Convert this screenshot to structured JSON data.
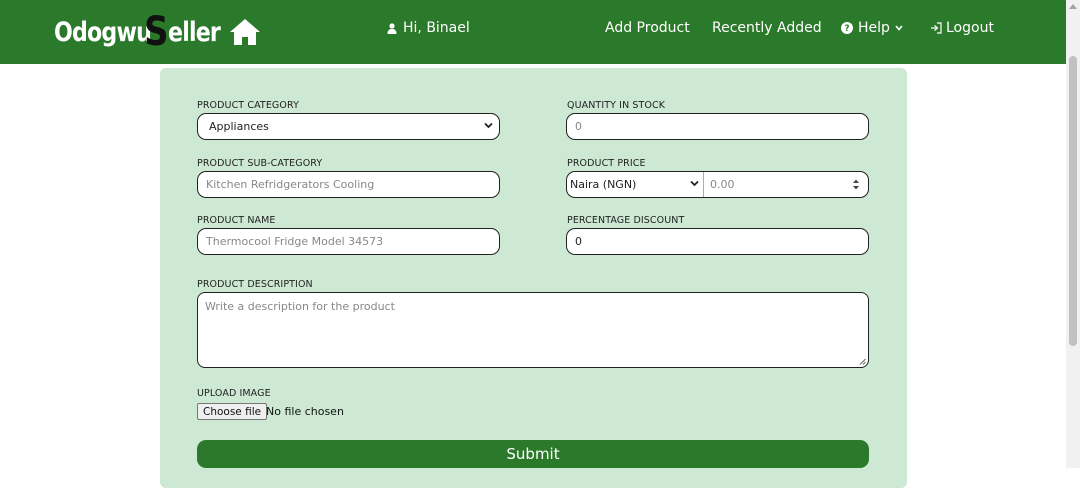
{
  "brand": {
    "part1": "Odogwu",
    "letter": "S",
    "part2": "eller",
    "icon": "home-icon"
  },
  "nav": {
    "greeting": "Hi, Binael",
    "greeting_icon": "user-icon",
    "add_product": "Add Product",
    "recently_added": "Recently Added",
    "help": "Help",
    "help_icon": "question-circle-icon",
    "logout": "Logout",
    "logout_icon": "sign-out-icon"
  },
  "form": {
    "category": {
      "label": "PRODUCT CATEGORY",
      "selected": "Appliances"
    },
    "quantity": {
      "label": "QUANTITY IN STOCK",
      "placeholder": "0"
    },
    "subcategory": {
      "label": "PRODUCT SUB-CATEGORY",
      "placeholder": "Kitchen Refridgerators Cooling"
    },
    "price": {
      "label": "PRODUCT PRICE",
      "currency": "Naira (NGN)",
      "placeholder": "0.00"
    },
    "name": {
      "label": "PRODUCT NAME",
      "placeholder": "Thermocool Fridge Model 34573"
    },
    "discount": {
      "label": "PERCENTAGE DISCOUNT",
      "value": "0"
    },
    "description": {
      "label": "PRODUCT DESCRIPTION",
      "placeholder": "Write a description for the product"
    },
    "image": {
      "label": "UPLOAD IMAGE",
      "button": "Choose file",
      "status": "No file chosen"
    },
    "submit": "Submit"
  },
  "colors": {
    "navbar": "#2b7a2b",
    "card": "#cde9d3",
    "submit": "#2b7a2b"
  }
}
